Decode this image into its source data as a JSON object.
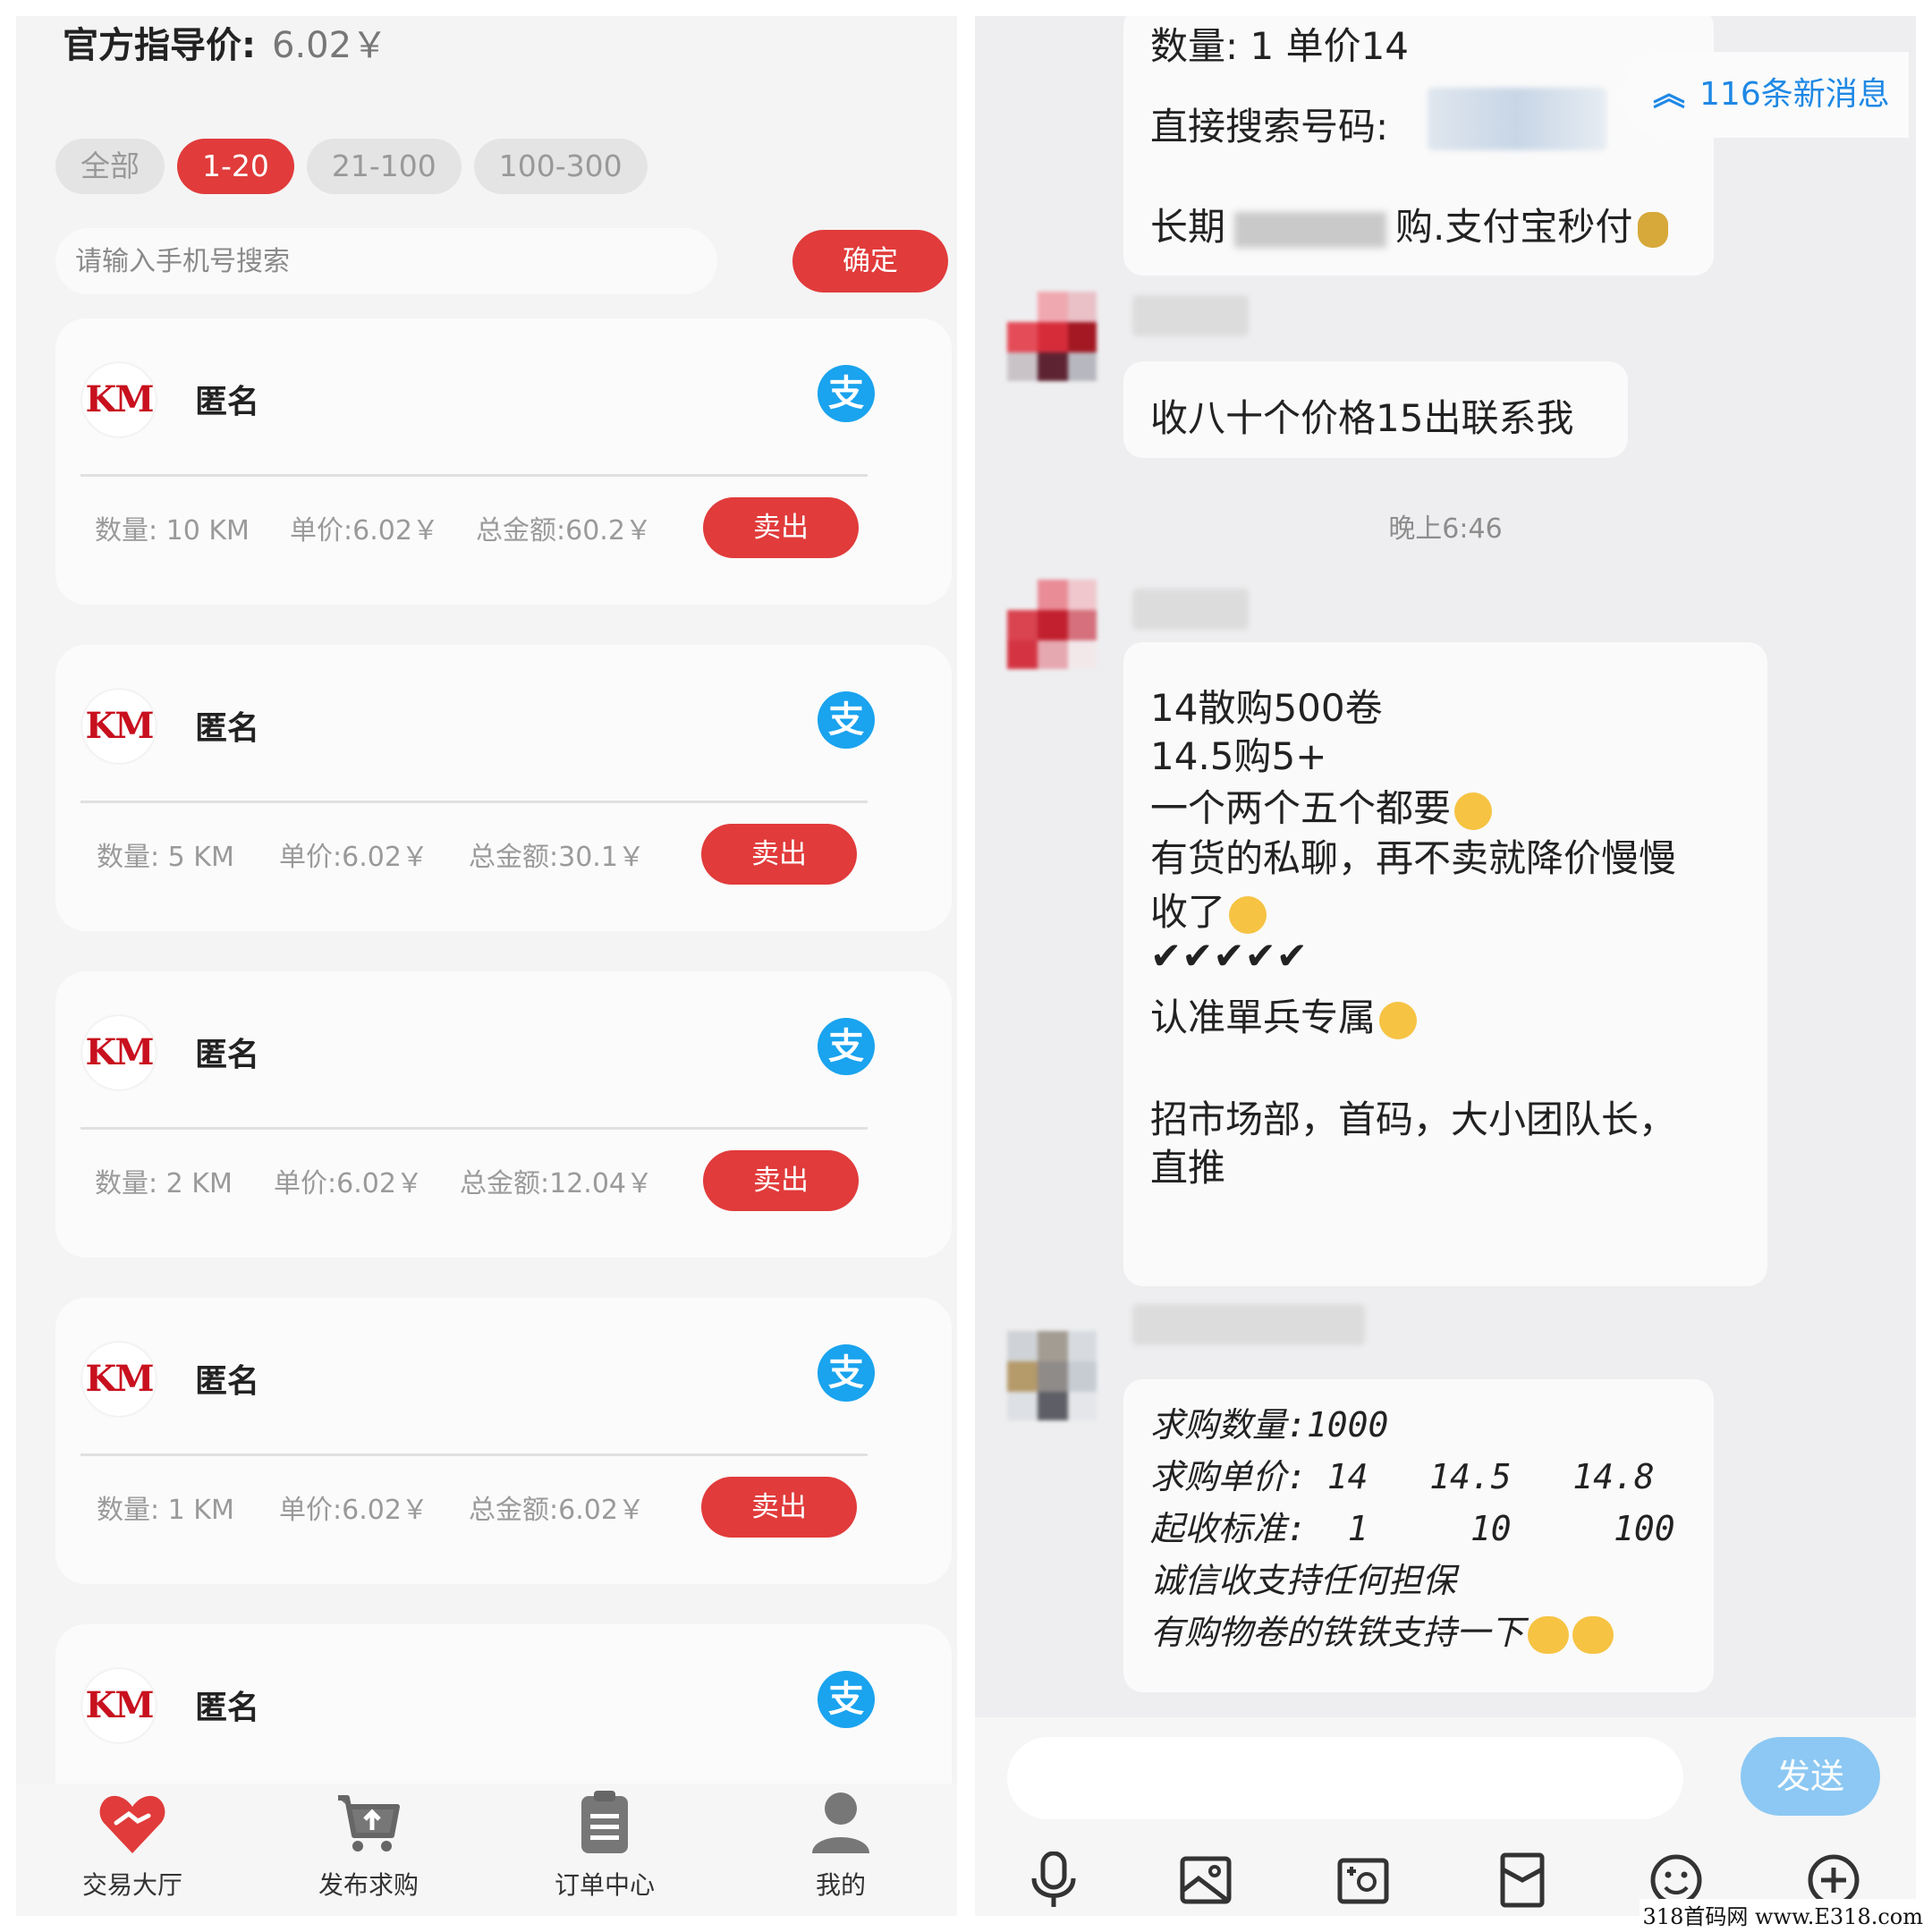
{
  "left": {
    "guide_label": "官方指导价:",
    "guide_value": "6.02￥",
    "filters": [
      "全部",
      "1-20",
      "21-100",
      "100-300"
    ],
    "active_filter": "1-20",
    "search_placeholder": "请输入手机号搜索",
    "confirm_label": "确定",
    "cards": [
      {
        "logo": "KM",
        "name": "匿名",
        "qty": "数量: 10 KM",
        "price": "单价:6.02￥",
        "total": "总金额:60.2￥",
        "action": "卖出"
      },
      {
        "logo": "KM",
        "name": "匿名",
        "qty": "数量: 5 KM",
        "price": "单价:6.02￥",
        "total": "总金额:30.1￥",
        "action": "卖出"
      },
      {
        "logo": "KM",
        "name": "匿名",
        "qty": "数量: 2 KM",
        "price": "单价:6.02￥",
        "total": "总金额:12.04￥",
        "action": "卖出"
      },
      {
        "logo": "KM",
        "name": "匿名",
        "qty": "数量: 1 KM",
        "price": "单价:6.02￥",
        "total": "总金额:6.02￥",
        "action": "卖出"
      },
      {
        "logo": "KM",
        "name": "匿名"
      }
    ],
    "alipay_glyph": "支",
    "tabs": [
      {
        "label": "交易大厅",
        "icon": "handshake-heart-icon",
        "color": "#e13b3b"
      },
      {
        "label": "发布求购",
        "icon": "cart-upload-icon"
      },
      {
        "label": "订单中心",
        "icon": "clipboard-icon"
      },
      {
        "label": "我的",
        "icon": "user-icon"
      }
    ]
  },
  "right": {
    "top_message": {
      "line1": "数量: 1        单价14",
      "line2": "直接搜索号码:",
      "line3_a": "长期",
      "line3_b": "购.支付宝秒付"
    },
    "new_messages": "116条新消息",
    "message_1": "收八十个价格15出联系我",
    "time": "晚上6:46",
    "message_2": [
      "14散购500卷",
      "14.5购5+",
      "一个两个五个都要",
      "有货的私聊，再不卖就降价慢慢",
      "收了",
      "✔✔✔✔✔",
      "认准單兵专属",
      "",
      "招市场部，首码，大小团队长，",
      "直推"
    ],
    "message_3": [
      "求购数量:1000",
      "求购单价: 14   14.5   14.8",
      "起收标准:  1     10     100",
      "诚信收支持任何担保",
      "有购物卷的铁铁支持一下"
    ],
    "send_label": "发送",
    "tools": [
      "microphone-icon",
      "image-icon",
      "camera-icon",
      "red-packet-icon",
      "emoji-icon",
      "plus-icon"
    ]
  },
  "watermark": "318首码网 www.E318.com",
  "colors": {
    "accent": "#e13b3b",
    "alipay": "#1aa3ee",
    "link": "#1e88e5"
  }
}
